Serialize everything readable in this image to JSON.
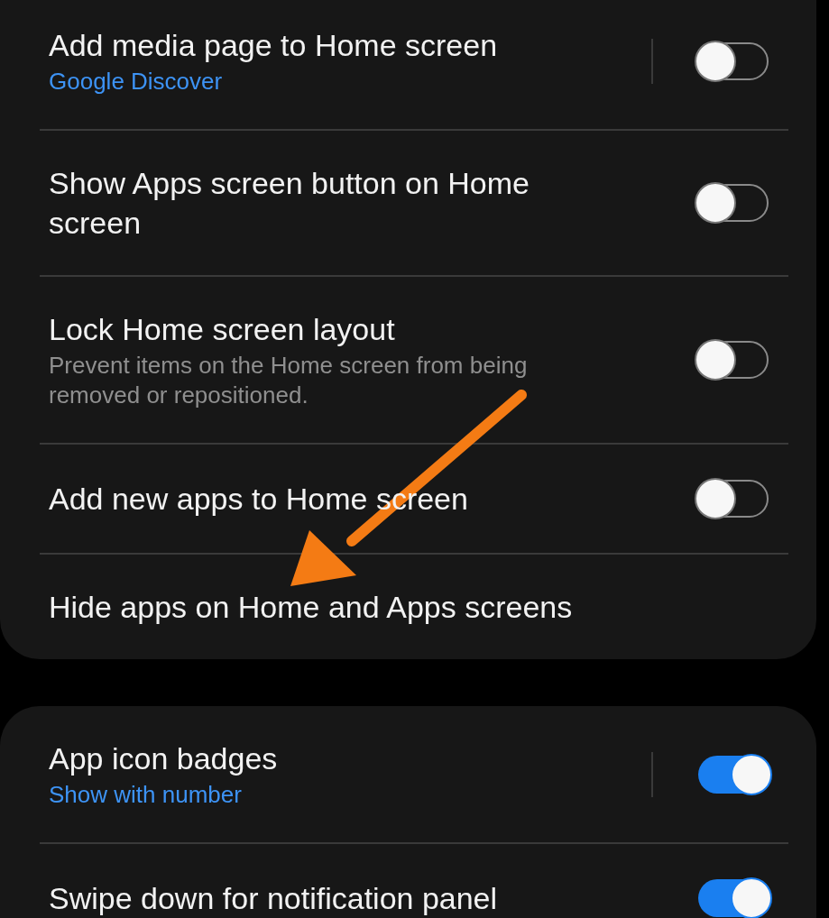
{
  "cards": [
    {
      "rows": [
        {
          "kind": "split",
          "title": "Add media page to Home screen",
          "subtitle": "Google Discover",
          "on": false
        },
        {
          "kind": "toggle",
          "title": "Show Apps screen button on Home screen",
          "on": false
        },
        {
          "kind": "toggle",
          "title": "Lock Home screen layout",
          "subtitle": "Prevent items on the Home screen from being removed or repositioned.",
          "on": false
        },
        {
          "kind": "toggle",
          "title": "Add new apps to Home screen",
          "on": false
        },
        {
          "kind": "action",
          "title": "Hide apps on Home and Apps screens"
        }
      ]
    },
    {
      "rows": [
        {
          "kind": "split",
          "title": "App icon badges",
          "subtitle": "Show with number",
          "on": true
        },
        {
          "kind": "toggle",
          "title": "Swipe down for notification panel",
          "on": true
        }
      ]
    }
  ]
}
